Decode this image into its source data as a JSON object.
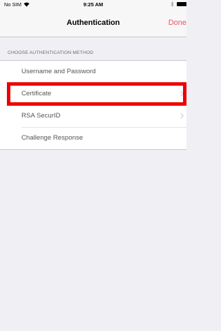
{
  "status_bar": {
    "carrier": "No SIM",
    "time": "9:25 AM"
  },
  "nav": {
    "title": "Authentication",
    "done_label": "Done",
    "accent_color": "#e8546a"
  },
  "section": {
    "header": "CHOOSE AUTHENTICATION METHOD"
  },
  "methods": [
    {
      "label": "Username and Password",
      "chevron": false
    },
    {
      "label": "Certificate",
      "chevron": true,
      "highlighted": true
    },
    {
      "label": "RSA SecurID",
      "chevron": true
    },
    {
      "label": "Challenge Response",
      "chevron": false
    }
  ],
  "icons": {
    "wifi": "wifi-icon",
    "bluetooth": "bluetooth-icon",
    "battery": "battery-icon",
    "chevron": "chevron-right-icon"
  },
  "highlight_color": "#ee0000"
}
